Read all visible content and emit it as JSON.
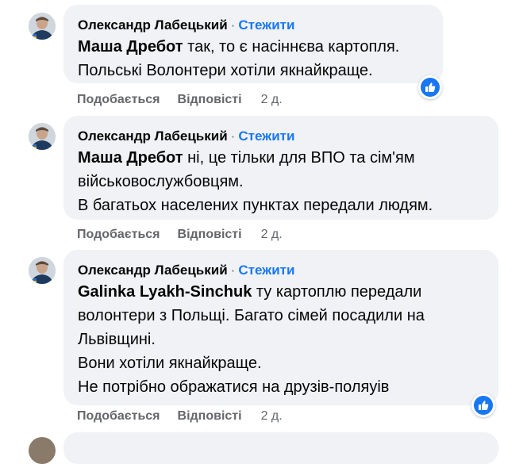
{
  "comments": [
    {
      "author": "Олександр Лабецький",
      "separator": "·",
      "follow_label": "Стежити",
      "mention": "Маша Дребот",
      "first_line_rest": " так, то є насіннєва картопля.",
      "lines": [
        "Польські Волонтери хотіли якнайкраще."
      ],
      "like_label": "Подобається",
      "reply_label": "Відповісті",
      "time": "2 д.",
      "has_reaction": true,
      "reaction_icon": "thumbs-up-icon"
    },
    {
      "author": "Олександр Лабецький",
      "separator": "·",
      "follow_label": "Стежити",
      "mention": "Маша Дребот",
      "first_line_rest": " ні, це тільки для ВПО та сім'ям",
      "lines": [
        "військовослужбовцям.",
        "В багатьох населених пунктах передали людям."
      ],
      "like_label": "Подобається",
      "reply_label": "Відповісті",
      "time": "2 д.",
      "has_reaction": false
    },
    {
      "author": "Олександр Лабецький",
      "separator": "·",
      "follow_label": "Стежити",
      "mention": "Galinka Lyakh-Sinchuk",
      "first_line_rest": " ту картоплю передали",
      "lines": [
        "волонтери з Польщі. Багато сімей посадили на",
        "Львівщині.",
        "Вони хотіли якнайкраще.",
        "Не потрібно ображатися на друзів-поляуів"
      ],
      "like_label": "Подобається",
      "reply_label": "Відповісті",
      "time": "2 д.",
      "has_reaction": true,
      "reaction_icon": "thumbs-up-icon"
    }
  ],
  "colors": {
    "bubble": "#f0f2f5",
    "link_blue": "#1877f2",
    "meta_gray": "#65676b"
  }
}
